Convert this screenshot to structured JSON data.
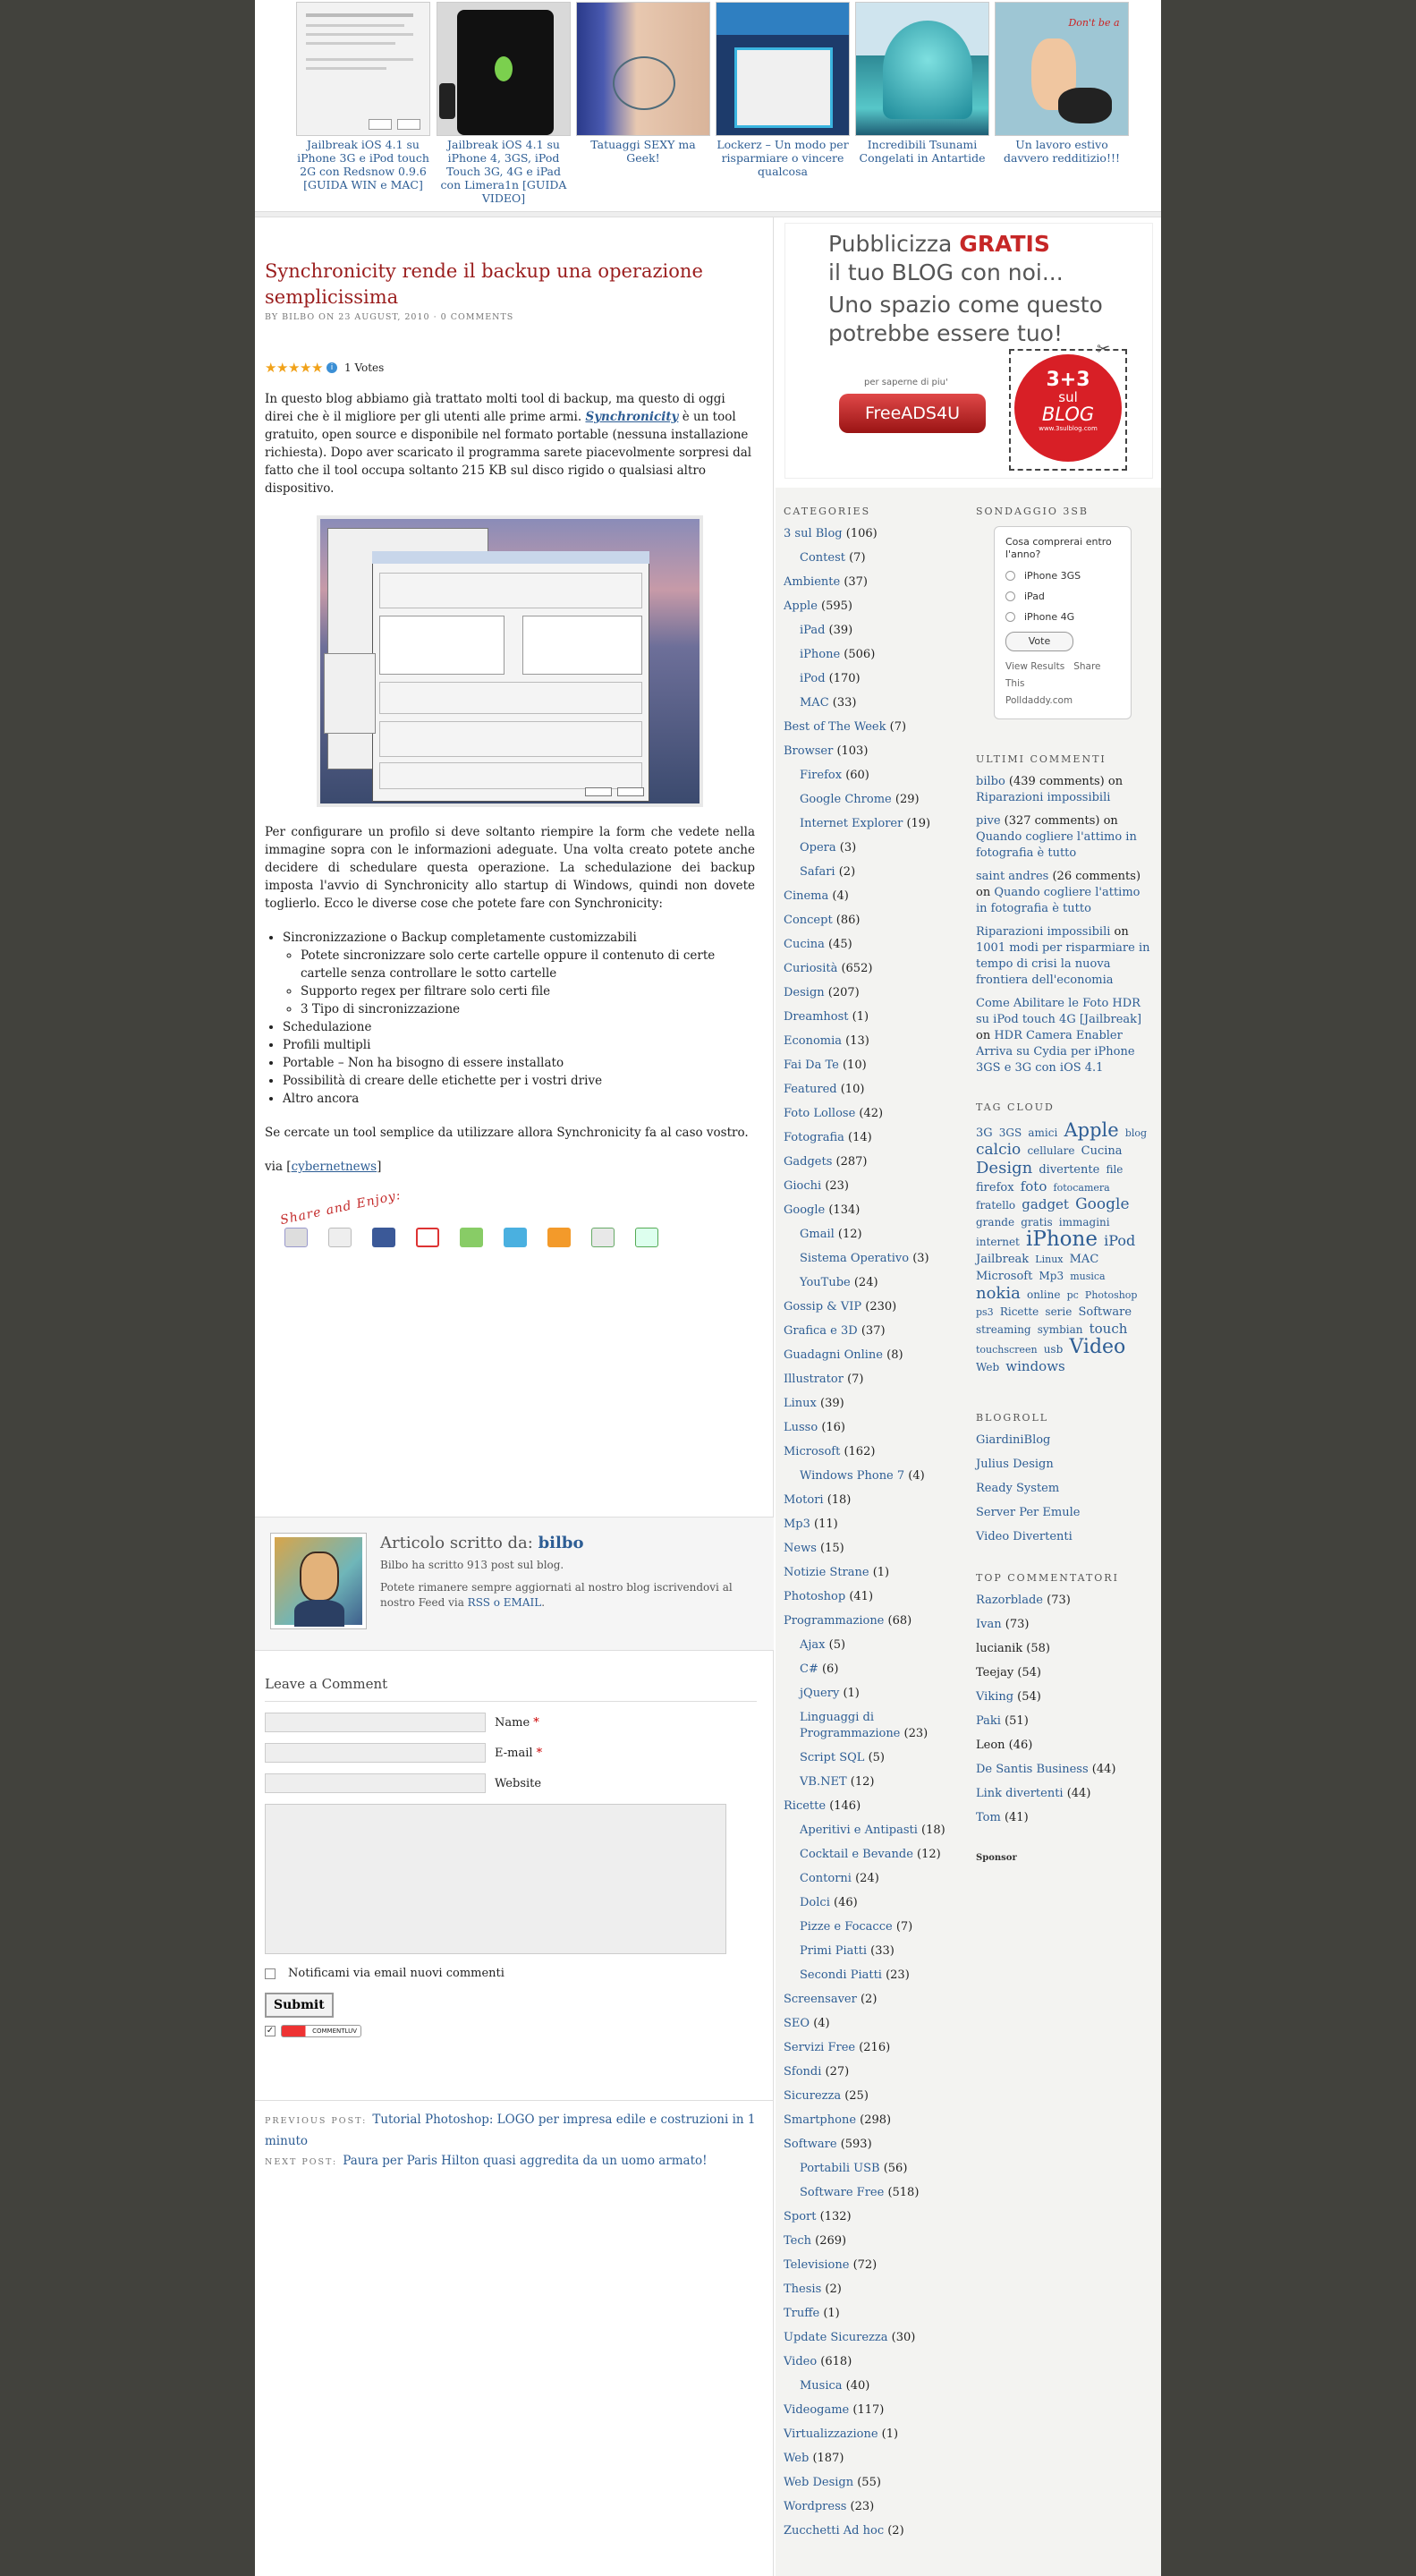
{
  "related": [
    {
      "title": "Jailbreak iOS 4.1 su iPhone 3G e iPod touch 2G con Redsnow 0.9.6 [GUIDA WIN e MAC]"
    },
    {
      "title": "Jailbreak iOS 4.1 su iPhone 4, 3GS, iPod Touch 3G, 4G e iPad con Limera1n [GUIDA VIDEO]"
    },
    {
      "title": "Tatuaggi SEXY ma Geek!"
    },
    {
      "title": "Lockerz – Un modo per risparmiare o vincere qualcosa"
    },
    {
      "title": "Incredibili Tsunami Congelati in Antartide"
    },
    {
      "title": "Un lavoro estivo davvero redditizio!!!"
    }
  ],
  "post": {
    "title": "Synchronicity rende il backup una operazione semplicissima",
    "meta_by": "By",
    "meta_author": "bilbo",
    "meta_on": "on",
    "meta_date": "23 August, 2010",
    "meta_sep": "·",
    "meta_comments": "0 Comments",
    "votes": "1 Votes",
    "p1_a": "In questo blog abbiamo già trattato molti tool di backup, ma questo di oggi direi che è il migliore per gli utenti alle prime armi. ",
    "p1_link": "Synchronicity",
    "p1_b": " è un tool gratuito, open source e disponibile nel formato portable (nessuna installazione richiesta). Dopo aver scaricato il programma sarete piacevolmente sorpresi dal fatto che il tool occupa soltanto 215 KB sul disco rigido o qualsiasi altro dispositivo.",
    "p2": "Per configurare un profilo si deve soltanto riempire la form che vedete nella immagine sopra con le informazioni adeguate. Una volta creato potete anche decidere di schedulare questa operazione. La schedulazione dei backup imposta l'avvio di Synchronicity allo startup di Windows, quindi non dovete toglierlo. Ecco le diverse cose che potete fare con Synchronicity:",
    "list1": "Sincronizzazione o Backup completamente customizzabili",
    "list1_sub": [
      "Potete sincronizzare solo certe cartelle oppure il contenuto di certe cartelle senza controllare le sotto cartelle",
      "Supporto regex per filtrare solo certi file",
      "3 Tipo di sincronizzazione"
    ],
    "list_rest": [
      "Schedulazione",
      "Profili multipli",
      "Portable – Non ha bisogno di essere installato",
      "Possibilità di creare delle etichette per i vostri drive",
      "Altro ancora"
    ],
    "p3": "Se cercate un tool semplice da utilizzare allora Synchronicity fa al caso vostro.",
    "via_a": "via [",
    "via_link": "cybernetnews",
    "via_b": "]",
    "share_title": "Share and Enjoy:"
  },
  "author": {
    "heading": "Articolo scritto da:",
    "name": "bilbo",
    "line1": "Bilbo ha scritto 913 post sul blog.",
    "line2_a": "Potete rimanere sempre aggiornati al nostro blog iscrivendovi al nostro Feed via ",
    "line2_link": "RSS o EMAIL",
    "line2_b": "."
  },
  "comments": {
    "heading": "Leave a Comment",
    "name_label": "Name",
    "email_label": "E-mail",
    "website_label": "Website",
    "required": "*",
    "notify": "Notificami via email nuovi commenti",
    "submit": "Submit",
    "commentluv": "COMMENTLUV"
  },
  "postnav": {
    "prev_label": "Previous post:",
    "prev": "Tutorial Photoshop: LOGO per impresa edile e costruzioni in 1 minuto",
    "next_label": "Next post:",
    "next": "Paura per Paris Hilton quasi aggredita da un uomo armato!"
  },
  "ad": {
    "line1a": "Pubblicizza ",
    "line1b": "GRATIS",
    "line2": "il tuo BLOG con noi...",
    "line3": "Uno spazio come questo",
    "line4": "potrebbe essere tuo!",
    "saperne": "per saperne di piu'",
    "button": "FreeADS4U",
    "badge1": "3+3",
    "badge2": "sul",
    "badge3": "BLOG",
    "badge4": "www.3sulblog.com"
  },
  "categories": {
    "title": "Categories",
    "items": [
      {
        "name": "3 sul Blog",
        "count": "(106)",
        "sub": false
      },
      {
        "name": "Contest",
        "count": "(7)",
        "sub": true
      },
      {
        "name": "Ambiente",
        "count": "(37)",
        "sub": false
      },
      {
        "name": "Apple",
        "count": "(595)",
        "sub": false
      },
      {
        "name": "iPad",
        "count": "(39)",
        "sub": true
      },
      {
        "name": "iPhone",
        "count": "(506)",
        "sub": true
      },
      {
        "name": "iPod",
        "count": "(170)",
        "sub": true
      },
      {
        "name": "MAC",
        "count": "(33)",
        "sub": true
      },
      {
        "name": "Best of The Week",
        "count": "(7)",
        "sub": false
      },
      {
        "name": "Browser",
        "count": "(103)",
        "sub": false
      },
      {
        "name": "Firefox",
        "count": "(60)",
        "sub": true
      },
      {
        "name": "Google Chrome",
        "count": "(29)",
        "sub": true
      },
      {
        "name": "Internet Explorer",
        "count": "(19)",
        "sub": true
      },
      {
        "name": "Opera",
        "count": "(3)",
        "sub": true
      },
      {
        "name": "Safari",
        "count": "(2)",
        "sub": true
      },
      {
        "name": "Cinema",
        "count": "(4)",
        "sub": false
      },
      {
        "name": "Concept",
        "count": "(86)",
        "sub": false
      },
      {
        "name": "Cucina",
        "count": "(45)",
        "sub": false
      },
      {
        "name": "Curiosità",
        "count": "(652)",
        "sub": false
      },
      {
        "name": "Design",
        "count": "(207)",
        "sub": false
      },
      {
        "name": "Dreamhost",
        "count": "(1)",
        "sub": false
      },
      {
        "name": "Economia",
        "count": "(13)",
        "sub": false
      },
      {
        "name": "Fai Da Te",
        "count": "(10)",
        "sub": false
      },
      {
        "name": "Featured",
        "count": "(10)",
        "sub": false
      },
      {
        "name": "Foto Lollose",
        "count": "(42)",
        "sub": false
      },
      {
        "name": "Fotografia",
        "count": "(14)",
        "sub": false
      },
      {
        "name": "Gadgets",
        "count": "(287)",
        "sub": false
      },
      {
        "name": "Giochi",
        "count": "(23)",
        "sub": false
      },
      {
        "name": "Google",
        "count": "(134)",
        "sub": false
      },
      {
        "name": "Gmail",
        "count": "(12)",
        "sub": true
      },
      {
        "name": "Sistema Operativo",
        "count": "(3)",
        "sub": true
      },
      {
        "name": "YouTube",
        "count": "(24)",
        "sub": true
      },
      {
        "name": "Gossip & VIP",
        "count": "(230)",
        "sub": false
      },
      {
        "name": "Grafica e 3D",
        "count": "(37)",
        "sub": false
      },
      {
        "name": "Guadagni Online",
        "count": "(8)",
        "sub": false
      },
      {
        "name": "Illustrator",
        "count": "(7)",
        "sub": false
      },
      {
        "name": "Linux",
        "count": "(39)",
        "sub": false
      },
      {
        "name": "Lusso",
        "count": "(16)",
        "sub": false
      },
      {
        "name": "Microsoft",
        "count": "(162)",
        "sub": false
      },
      {
        "name": "Windows Phone 7",
        "count": "(4)",
        "sub": true
      },
      {
        "name": "Motori",
        "count": "(18)",
        "sub": false
      },
      {
        "name": "Mp3",
        "count": "(11)",
        "sub": false
      },
      {
        "name": "News",
        "count": "(15)",
        "sub": false
      },
      {
        "name": "Notizie Strane",
        "count": "(1)",
        "sub": false
      },
      {
        "name": "Photoshop",
        "count": "(41)",
        "sub": false
      },
      {
        "name": "Programmazione",
        "count": "(68)",
        "sub": false
      },
      {
        "name": "Ajax",
        "count": "(5)",
        "sub": true
      },
      {
        "name": "C#",
        "count": "(6)",
        "sub": true
      },
      {
        "name": "jQuery",
        "count": "(1)",
        "sub": true
      },
      {
        "name": "Linguaggi di Programmazione",
        "count": "(23)",
        "sub": true
      },
      {
        "name": "Script SQL",
        "count": "(5)",
        "sub": true
      },
      {
        "name": "VB.NET",
        "count": "(12)",
        "sub": true
      },
      {
        "name": "Ricette",
        "count": "(146)",
        "sub": false
      },
      {
        "name": "Aperitivi e Antipasti",
        "count": "(18)",
        "sub": true
      },
      {
        "name": "Cocktail e Bevande",
        "count": "(12)",
        "sub": true
      },
      {
        "name": "Contorni",
        "count": "(24)",
        "sub": true
      },
      {
        "name": "Dolci",
        "count": "(46)",
        "sub": true
      },
      {
        "name": "Pizze e Focacce",
        "count": "(7)",
        "sub": true
      },
      {
        "name": "Primi Piatti",
        "count": "(33)",
        "sub": true
      },
      {
        "name": "Secondi Piatti",
        "count": "(23)",
        "sub": true
      },
      {
        "name": "Screensaver",
        "count": "(2)",
        "sub": false
      },
      {
        "name": "SEO",
        "count": "(4)",
        "sub": false
      },
      {
        "name": "Servizi Free",
        "count": "(216)",
        "sub": false
      },
      {
        "name": "Sfondi",
        "count": "(27)",
        "sub": false
      },
      {
        "name": "Sicurezza",
        "count": "(25)",
        "sub": false
      },
      {
        "name": "Smartphone",
        "count": "(298)",
        "sub": false
      },
      {
        "name": "Software",
        "count": "(593)",
        "sub": false
      },
      {
        "name": "Portabili USB",
        "count": "(56)",
        "sub": true
      },
      {
        "name": "Software Free",
        "count": "(518)",
        "sub": true
      },
      {
        "name": "Sport",
        "count": "(132)",
        "sub": false
      },
      {
        "name": "Tech",
        "count": "(269)",
        "sub": false
      },
      {
        "name": "Televisione",
        "count": "(72)",
        "sub": false
      },
      {
        "name": "Thesis",
        "count": "(2)",
        "sub": false
      },
      {
        "name": "Truffe",
        "count": "(1)",
        "sub": false
      },
      {
        "name": "Update Sicurezza",
        "count": "(30)",
        "sub": false
      },
      {
        "name": "Video",
        "count": "(618)",
        "sub": false
      },
      {
        "name": "Musica",
        "count": "(40)",
        "sub": true
      },
      {
        "name": "Videogame",
        "count": "(117)",
        "sub": false
      },
      {
        "name": "Virtualizzazione",
        "count": "(1)",
        "sub": false
      },
      {
        "name": "Web",
        "count": "(187)",
        "sub": false
      },
      {
        "name": "Web Design",
        "count": "(55)",
        "sub": false
      },
      {
        "name": "Wordpress",
        "count": "(23)",
        "sub": false
      },
      {
        "name": "Zucchetti Ad hoc",
        "count": "(2)",
        "sub": false
      }
    ]
  },
  "poll": {
    "title": "Sondaggio 3sB",
    "question": "Cosa comprerai entro l'anno?",
    "options": [
      "iPhone 3GS",
      "iPad",
      "iPhone 4G"
    ],
    "vote": "Vote",
    "view": "View Results",
    "share": "Share This",
    "brand": "Polldaddy.com"
  },
  "recent_comments": {
    "title": "Ultimi Commenti",
    "items": [
      {
        "author": "bilbo",
        "count": " (439 comments) on ",
        "post": "Riparazioni impossibili",
        "author_link": true
      },
      {
        "author": "pive",
        "count": " (327 comments) on ",
        "post": "Quando cogliere l'attimo in fotografia è tutto",
        "author_link": true
      },
      {
        "author": "saint andres",
        "count": " (26 comments) on ",
        "post": "Quando cogliere l'attimo in fotografia è tutto",
        "author_link": true
      },
      {
        "author": "Riparazioni impossibili",
        "count": " on ",
        "post": "1001 modi per risparmiare in tempo di crisi la nuova frontiera dell'economia",
        "author_link": true
      },
      {
        "author": "Come Abilitare le Foto HDR su iPod touch 4G [Jailbreak]",
        "count": " on ",
        "post": "HDR Camera Enabler Arriva su Cydia per iPhone 3GS e 3G con iOS 4.1",
        "author_link": true
      }
    ]
  },
  "tag_cloud": {
    "title": "Tag Cloud",
    "tags": [
      {
        "t": "3G",
        "s": 13
      },
      {
        "t": "3GS",
        "s": 12
      },
      {
        "t": "amici",
        "s": 12
      },
      {
        "t": "Apple",
        "s": 21
      },
      {
        "t": "blog",
        "s": 11
      },
      {
        "t": "calcio",
        "s": 17
      },
      {
        "t": "cellulare",
        "s": 12
      },
      {
        "t": "Cucina",
        "s": 13
      },
      {
        "t": "Design",
        "s": 18
      },
      {
        "t": "divertente",
        "s": 13
      },
      {
        "t": "file",
        "s": 12
      },
      {
        "t": "firefox",
        "s": 13
      },
      {
        "t": "foto",
        "s": 15
      },
      {
        "t": "fotocamera",
        "s": 11
      },
      {
        "t": "fratello",
        "s": 12
      },
      {
        "t": "gadget",
        "s": 15
      },
      {
        "t": "Google",
        "s": 17
      },
      {
        "t": "grande",
        "s": 12
      },
      {
        "t": "gratis",
        "s": 12
      },
      {
        "t": "immagini",
        "s": 12
      },
      {
        "t": "internet",
        "s": 12
      },
      {
        "t": "iPhone",
        "s": 23
      },
      {
        "t": "iPod",
        "s": 16
      },
      {
        "t": "Jailbreak",
        "s": 13
      },
      {
        "t": "Linux",
        "s": 11
      },
      {
        "t": "MAC",
        "s": 13
      },
      {
        "t": "Microsoft",
        "s": 13
      },
      {
        "t": "Mp3",
        "s": 12
      },
      {
        "t": "musica",
        "s": 11
      },
      {
        "t": "nokia",
        "s": 18
      },
      {
        "t": "online",
        "s": 12
      },
      {
        "t": "pc",
        "s": 11
      },
      {
        "t": "Photoshop",
        "s": 11
      },
      {
        "t": "ps3",
        "s": 11
      },
      {
        "t": "Ricette",
        "s": 12
      },
      {
        "t": "serie",
        "s": 12
      },
      {
        "t": "Software",
        "s": 13
      },
      {
        "t": "streaming",
        "s": 12
      },
      {
        "t": "symbian",
        "s": 12
      },
      {
        "t": "touch",
        "s": 15
      },
      {
        "t": "touchscreen",
        "s": 11
      },
      {
        "t": "usb",
        "s": 12
      },
      {
        "t": "Video",
        "s": 22
      },
      {
        "t": "Web",
        "s": 12
      },
      {
        "t": "windows",
        "s": 15
      }
    ]
  },
  "blogroll": {
    "title": "Blogroll",
    "items": [
      "GiardiniBlog",
      "Julius Design",
      "Ready System",
      "Server Per Emule",
      "Video Divertenti"
    ]
  },
  "top_commenters": {
    "title": "Top commentatori",
    "items": [
      {
        "name": "Razorblade",
        "count": " (73)",
        "link": true
      },
      {
        "name": "Ivan",
        "count": " (73)",
        "link": true
      },
      {
        "name": "lucianik",
        "count": " (58)",
        "link": false
      },
      {
        "name": "Teejay",
        "count": " (54)",
        "link": false
      },
      {
        "name": "Viking",
        "count": " (54)",
        "link": true
      },
      {
        "name": "Paki",
        "count": " (51)",
        "link": true
      },
      {
        "name": "Leon",
        "count": " (46)",
        "link": false
      },
      {
        "name": "De Santis Business",
        "count": " (44)",
        "link": true
      },
      {
        "name": "Link divertenti",
        "count": " (44)",
        "link": true
      },
      {
        "name": "Tom",
        "count": " (41)",
        "link": true
      }
    ]
  },
  "sponsor": "Sponsor",
  "colors": {
    "link": "#2d5d94",
    "title": "#9a1d1d",
    "background": "#42423d",
    "sidebar": "#f3f3f1"
  }
}
